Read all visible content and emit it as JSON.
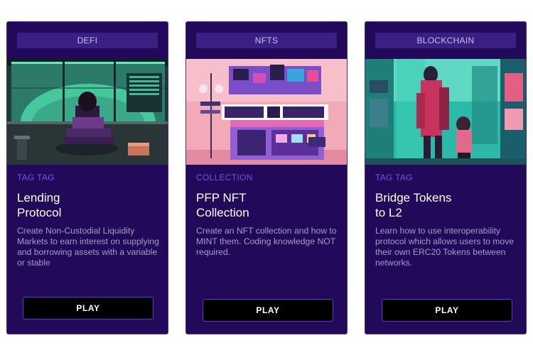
{
  "cards": [
    {
      "category": "DEFI",
      "tag": "TAG TAG",
      "title_line1": "Lending",
      "title_line2": "Protocol",
      "description": "Create Non-Custodial Liquidity Markets to earn interest on supplying and borrowing assets with a variable or stable",
      "play_label": "PLAY",
      "image": "pixel-art-person-watching-screens"
    },
    {
      "category": "NFTS",
      "tag": "COLLECTION",
      "title_line1": "PFP NFT",
      "title_line2": "Collection",
      "description": "Create an NFT collection and how to MINT them. Coding knowledge NOT required.",
      "play_label": "PLAY",
      "image": "pixel-art-neon-shop"
    },
    {
      "category": "BLOCKCHAIN",
      "tag": "TAG TAG",
      "title_line1": "Bridge Tokens",
      "title_line2": "to L2",
      "description": "Learn how to use interoperability protocol which allows users to move their own ERC20 Tokens between networks.",
      "play_label": "PLAY",
      "image": "pixel-art-city-characters"
    }
  ],
  "colors": {
    "card_bg": "#22095a",
    "category_bar": "#3b1f82",
    "tag": "#7a52e8",
    "button_bg": "#000000",
    "button_border": "#5b3cc4"
  }
}
